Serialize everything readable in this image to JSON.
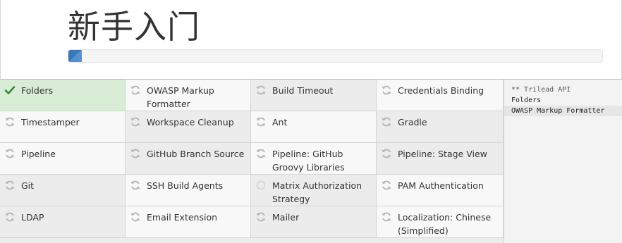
{
  "header": {
    "title": "新手入门",
    "progress": 0.025
  },
  "plugins": [
    {
      "name": "Folders",
      "status": "installed",
      "icon": "check-icon"
    },
    {
      "name": "OWASP Markup Formatter",
      "status": "installing",
      "icon": "refresh-icon"
    },
    {
      "name": "Build Timeout",
      "status": "pending",
      "icon": "refresh-icon"
    },
    {
      "name": "Credentials Binding",
      "status": "pending",
      "icon": "refresh-icon"
    },
    {
      "name": "Timestamper",
      "status": "pending",
      "icon": "refresh-icon"
    },
    {
      "name": "Workspace Cleanup",
      "status": "pending",
      "icon": "refresh-icon"
    },
    {
      "name": "Ant",
      "status": "pending",
      "icon": "refresh-icon"
    },
    {
      "name": "Gradle",
      "status": "pending",
      "icon": "refresh-icon"
    },
    {
      "name": "Pipeline",
      "status": "pending",
      "icon": "refresh-icon"
    },
    {
      "name": "GitHub Branch Source",
      "status": "pending",
      "icon": "refresh-icon"
    },
    {
      "name": "Pipeline: GitHub Groovy Libraries",
      "status": "pending",
      "icon": "refresh-icon"
    },
    {
      "name": "Pipeline: Stage View",
      "status": "pending",
      "icon": "refresh-icon"
    },
    {
      "name": "Git",
      "status": "pending",
      "icon": "refresh-icon"
    },
    {
      "name": "SSH Build Agents",
      "status": "pending",
      "icon": "refresh-icon"
    },
    {
      "name": "Matrix Authorization Strategy",
      "status": "queued",
      "icon": "circle-icon"
    },
    {
      "name": "PAM Authentication",
      "status": "pending",
      "icon": "refresh-icon"
    },
    {
      "name": "LDAP",
      "status": "pending",
      "icon": "refresh-icon"
    },
    {
      "name": "Email Extension",
      "status": "pending",
      "icon": "refresh-icon"
    },
    {
      "name": "Mailer",
      "status": "pending",
      "icon": "refresh-icon"
    },
    {
      "name": "Localization: Chinese (Simplified)",
      "status": "pending",
      "icon": "refresh-icon"
    }
  ],
  "log": [
    "** Trilead API",
    "Folders",
    "OWASP Markup Formatter"
  ],
  "colors": {
    "success_bg": "#d8ecd6",
    "check": "#3a8a3a",
    "progress": "#3b78b8"
  }
}
